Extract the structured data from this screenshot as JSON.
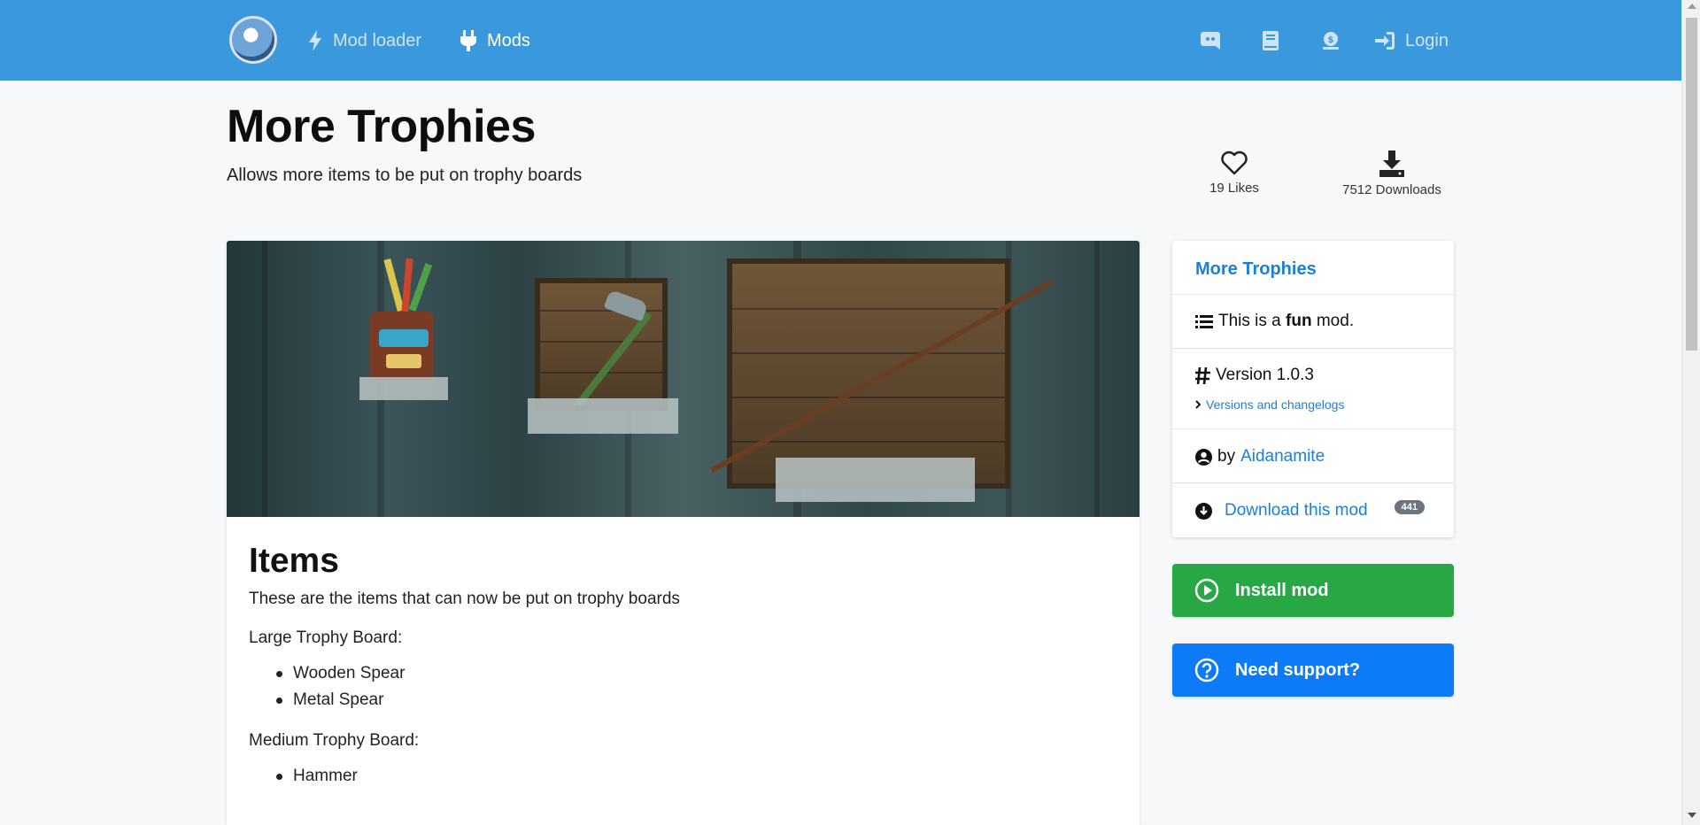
{
  "nav": {
    "mod_loader": "Mod loader",
    "mods": "Mods",
    "login": "Login",
    "icons": [
      "discord-icon",
      "book-icon",
      "donate-icon",
      "login-icon"
    ]
  },
  "header": {
    "title": "More Trophies",
    "subtitle": "Allows more items to be put on trophy boards",
    "likes": "19 Likes",
    "downloads": "7512 Downloads"
  },
  "content": {
    "heading": "Items",
    "intro": "These are the items that can now be put on trophy boards",
    "sections": [
      {
        "label": "Large Trophy Board:",
        "items": [
          "Wooden Spear",
          "Metal Spear"
        ]
      },
      {
        "label": "Medium Trophy Board:",
        "items": [
          "Hammer"
        ]
      }
    ]
  },
  "sidebar": {
    "title": "More Trophies",
    "tagline_prefix": "This is a ",
    "tagline_bold": "fun",
    "tagline_suffix": " mod.",
    "version": "Version 1.0.3",
    "versions_link": "Versions and changelogs",
    "by": "by",
    "author": "Aidanamite",
    "download_label": "Download this mod",
    "download_count": "441",
    "install_label": "Install mod",
    "support_label": "Need support?"
  },
  "colors": {
    "navbar": "#3a99dc",
    "link": "#1a7fe0",
    "install": "#28a745",
    "support": "#0d7bf7"
  }
}
